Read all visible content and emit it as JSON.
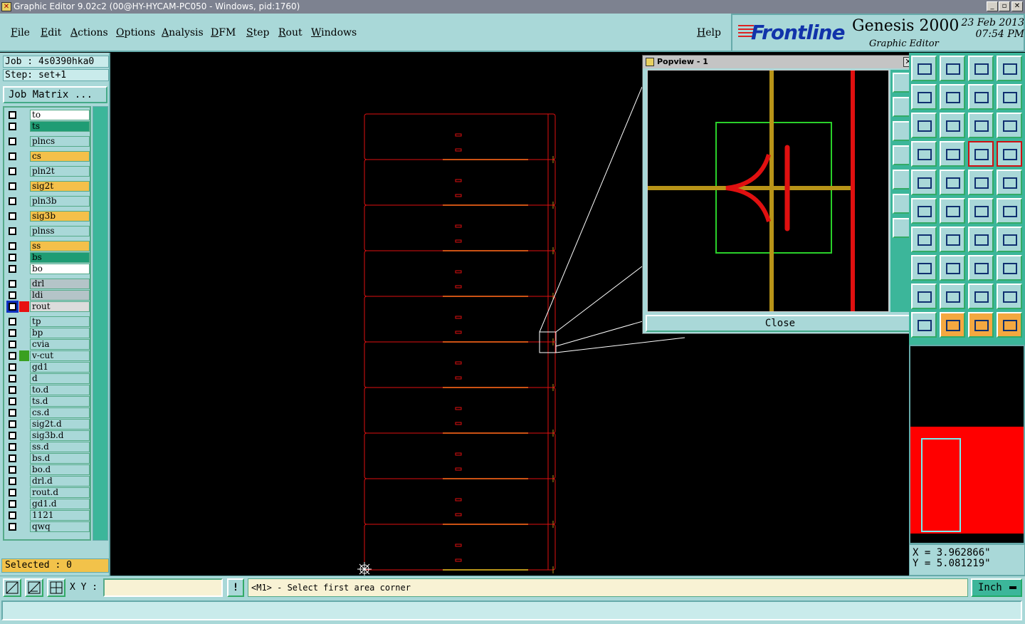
{
  "window": {
    "title": "Graphic Editor 9.02c2 (00@HY-HYCAM-PC050 - Windows, pid:1760)",
    "buttons": [
      "_",
      "▫",
      "✕"
    ]
  },
  "menu": {
    "items": [
      "File",
      "Edit",
      "Actions",
      "Options",
      "Analysis",
      "DFM",
      "Step",
      "Rout",
      "Windows"
    ],
    "help": "Help"
  },
  "branding": {
    "logo": "Frontline",
    "product": "Genesis 2000",
    "subtitle": "Graphic Editor",
    "date": "23 Feb 2013",
    "time": "07:54 PM"
  },
  "job": {
    "job_label": "Job : 4s0390hka0",
    "step_label": "Step: set+1",
    "matrix_button": "Job Matrix ..."
  },
  "layers": [
    {
      "name": "to",
      "color": "#ffffff",
      "swatch": ""
    },
    {
      "name": "ts",
      "color": "#1f9c74",
      "swatch": ""
    },
    {
      "name": "plncs",
      "color": "#a9d8d8",
      "swatch": ""
    },
    {
      "name": "cs",
      "color": "#f4c04a",
      "swatch": ""
    },
    {
      "name": "pln2t",
      "color": "#a9d8d8",
      "swatch": ""
    },
    {
      "name": "sig2t",
      "color": "#f4c04a",
      "swatch": ""
    },
    {
      "name": "pln3b",
      "color": "#a9d8d8",
      "swatch": ""
    },
    {
      "name": "sig3b",
      "color": "#f4c04a",
      "swatch": ""
    },
    {
      "name": "plnss",
      "color": "#a9d8d8",
      "swatch": ""
    },
    {
      "name": "ss",
      "color": "#f4c04a",
      "swatch": ""
    },
    {
      "name": "bs",
      "color": "#1f9c74",
      "swatch": ""
    },
    {
      "name": "bo",
      "color": "#ffffff",
      "swatch": ""
    },
    {
      "name": "drl",
      "color": "#b4c4c8",
      "swatch": ""
    },
    {
      "name": "ldi",
      "color": "#b4c4c8",
      "swatch": ""
    },
    {
      "name": "rout",
      "color": "#dcdcdc",
      "swatch": "#e81010"
    },
    {
      "name": "tp",
      "color": "#a9d8d8",
      "swatch": ""
    },
    {
      "name": "bp",
      "color": "#a9d8d8",
      "swatch": ""
    },
    {
      "name": "cvia",
      "color": "#a9d8d8",
      "swatch": ""
    },
    {
      "name": "v-cut",
      "color": "#a9d8d8",
      "swatch": "#3aa020"
    },
    {
      "name": "gd1",
      "color": "#a9d8d8",
      "swatch": ""
    },
    {
      "name": "d",
      "color": "#a9d8d8",
      "swatch": ""
    },
    {
      "name": "to.d",
      "color": "#a9d8d8",
      "swatch": ""
    },
    {
      "name": "ts.d",
      "color": "#a9d8d8",
      "swatch": ""
    },
    {
      "name": "cs.d",
      "color": "#a9d8d8",
      "swatch": ""
    },
    {
      "name": "sig2t.d",
      "color": "#a9d8d8",
      "swatch": ""
    },
    {
      "name": "sig3b.d",
      "color": "#a9d8d8",
      "swatch": ""
    },
    {
      "name": "ss.d",
      "color": "#a9d8d8",
      "swatch": ""
    },
    {
      "name": "bs.d",
      "color": "#a9d8d8",
      "swatch": ""
    },
    {
      "name": "bo.d",
      "color": "#a9d8d8",
      "swatch": ""
    },
    {
      "name": "drl.d",
      "color": "#a9d8d8",
      "swatch": ""
    },
    {
      "name": "rout.d",
      "color": "#a9d8d8",
      "swatch": ""
    },
    {
      "name": "gd1.d",
      "color": "#a9d8d8",
      "swatch": ""
    },
    {
      "name": "1121",
      "color": "#a9d8d8",
      "swatch": ""
    },
    {
      "name": "qwq",
      "color": "#a9d8d8",
      "swatch": ""
    }
  ],
  "selected_label": "Selected : 0",
  "popview": {
    "title": "Popview - 1",
    "close_label": "Close"
  },
  "coords": {
    "x": "X = 3.962866\"",
    "y": "Y = 5.081219\""
  },
  "command": {
    "xy_label": "X Y :",
    "xy_value": "",
    "bang": "!",
    "prompt": "<M1> - Select first area corner",
    "units": "Inch"
  },
  "status": ""
}
